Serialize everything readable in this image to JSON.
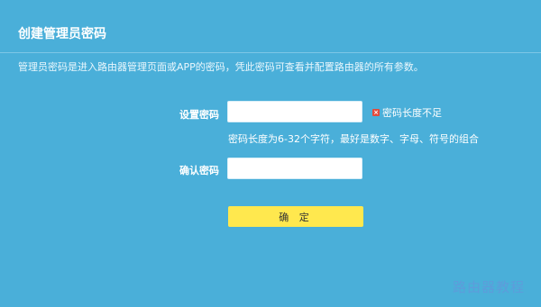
{
  "header": {
    "title": "创建管理员密码"
  },
  "description": "管理员密码是进入路由器管理页面或APP的密码，凭此密码可查看并配置路由器的所有参数。",
  "form": {
    "password_label": "设置密码",
    "password_value": "",
    "error_text": "密码长度不足",
    "hint_text": "密码长度为6-32个字符，最好是数字、字母、符号的组合",
    "confirm_label": "确认密码",
    "confirm_value": "",
    "submit_label": "确 定"
  },
  "watermark": "路由器教程",
  "colors": {
    "background": "#4aafd9",
    "button": "#ffe84e",
    "error": "#e34b3c"
  }
}
